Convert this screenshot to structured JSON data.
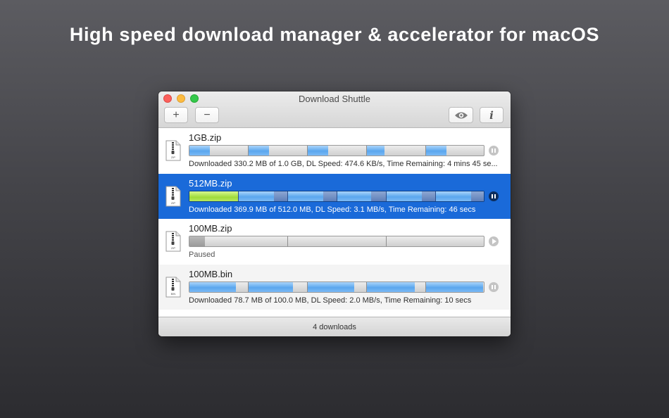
{
  "headline": "High speed download manager & accelerator for macOS",
  "window": {
    "title": "Download Shuttle",
    "toolbar": {
      "add_label": "+",
      "remove_label": "−",
      "info_label": "i"
    },
    "footer": "4 downloads"
  },
  "downloads": [
    {
      "name": "1GB.zip",
      "icon_label": "ZIP",
      "status": "Downloaded 330.2 MB of 1.0 GB, DL Speed: 474.6 KB/s, Time Remaining: 4 mins 45 se...",
      "control": "pause",
      "selected": false,
      "segments": [
        0.35,
        0.35,
        0.35,
        0.3,
        0.35
      ]
    },
    {
      "name": "512MB.zip",
      "icon_label": "ZIP",
      "status": "Downloaded 369.9 MB of 512.0 MB, DL Speed: 3.1 MB/s, Time Remaining: 46 secs",
      "control": "pause",
      "selected": true,
      "segments": [
        1.0,
        0.72,
        0.72,
        0.7,
        0.72,
        0.72
      ]
    },
    {
      "name": "100MB.zip",
      "icon_label": "ZIP",
      "status": "Paused",
      "control": "play",
      "selected": false,
      "segments": [
        0.16,
        0.0,
        0.0
      ]
    },
    {
      "name": "100MB.bin",
      "icon_label": "BIN",
      "status": "Downloaded 78.7 MB of 100.0 MB, DL Speed: 2.0 MB/s, Time Remaining: 10 secs",
      "control": "pause",
      "selected": false,
      "segments": [
        0.8,
        0.76,
        0.8,
        0.82,
        0.96
      ]
    }
  ],
  "colors": {
    "selection": "#1a6ad9",
    "progress_blue": "#5ba7ee",
    "progress_green": "#9fdb3a"
  }
}
